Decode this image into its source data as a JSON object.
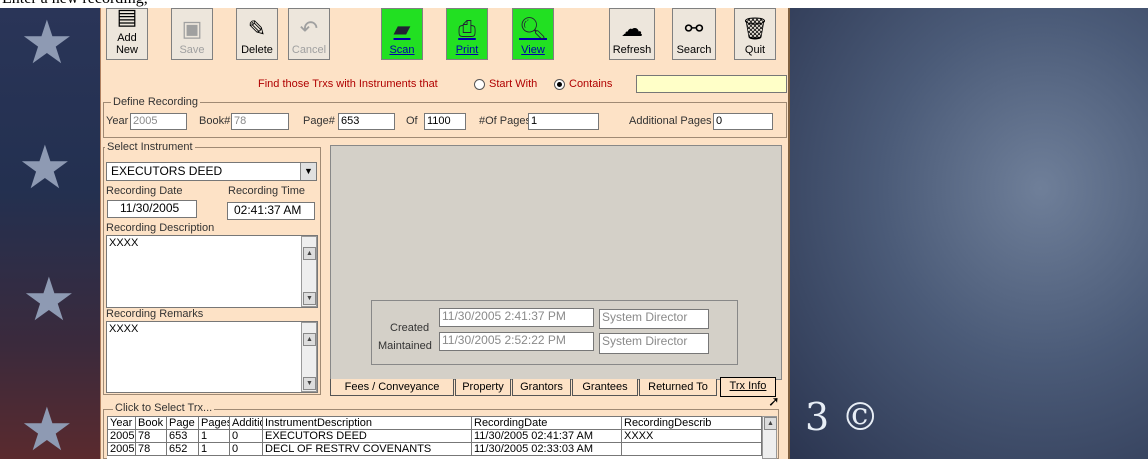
{
  "caption_fragment": "Enter a new recording,",
  "toolbar": {
    "add_new": "Add New",
    "save": "Save",
    "delete": "Delete",
    "cancel": "Cancel",
    "scan": "Scan",
    "print": "Print",
    "view": "View",
    "refresh": "Refresh",
    "search": "Search",
    "quit": "Quit"
  },
  "find": {
    "prompt": "Find those Trxs with Instruments that",
    "start_with": "Start With",
    "contains": "Contains",
    "selected": "Contains",
    "value": ""
  },
  "define_recording": {
    "title": "Define Recording",
    "year_label": "Year",
    "year": "2005",
    "book_label": "Book#",
    "book": "78",
    "page_label": "Page#",
    "page": "653",
    "of_label": "Of",
    "of": "1100",
    "num_pages_label": "#Of Pages",
    "num_pages": "1",
    "additional_label": "Additional Pages",
    "additional": "0"
  },
  "instrument": {
    "title": "Select Instrument",
    "selected": "EXECUTORS DEED",
    "date_label": "Recording Date",
    "date": "11/30/2005",
    "time_label": "Recording Time",
    "time": "02:41:37 AM",
    "desc_label": "Recording Description",
    "desc": "XXXX",
    "remarks_label": "Recording Remarks",
    "remarks": "XXXX"
  },
  "audit": {
    "created_label": "Created",
    "created": "11/30/2005 2:41:37 PM",
    "created_by": "System Director",
    "maintained_label": "Maintained",
    "maintained": "11/30/2005 2:52:22 PM",
    "maintained_by": "System Director"
  },
  "tabs": [
    "Fees / Conveyance",
    "Property",
    "Grantors",
    "Grantees",
    "Returned To",
    "Trx Info"
  ],
  "active_tab": "Trx Info",
  "grid": {
    "title": "Click to Select Trx...",
    "columns": [
      "Year",
      "Book",
      "Page",
      "Pages",
      "Additio",
      "InstrumentDescription",
      "RecordingDate",
      "RecordingDescrib"
    ],
    "rows": [
      [
        "2005",
        "78",
        "653",
        "1",
        "0",
        "EXECUTORS DEED",
        "11/30/2005 02:41:37 AM",
        "XXXX"
      ],
      [
        "2005",
        "78",
        "652",
        "1",
        "0",
        "DECL OF RESTRV COVENANTS",
        "11/30/2005 02:33:03 AM",
        ""
      ]
    ]
  },
  "watermark": "3 ©"
}
